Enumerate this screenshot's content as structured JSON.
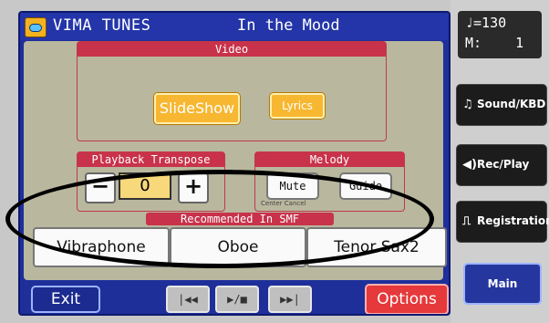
{
  "titlebar": {
    "app_name": "VIMA TUNES",
    "song_title": "In the Mood"
  },
  "video": {
    "header": "Video",
    "slideshow_label": "SlideShow",
    "lyrics_label": "Lyrics"
  },
  "transpose": {
    "header": "Playback Transpose",
    "minus_label": "−",
    "value": "0",
    "plus_label": "+"
  },
  "melody": {
    "header": "Melody",
    "mute_label": "Mute",
    "guide_label": "Guide",
    "center_cancel": "Center Cancel"
  },
  "smf": {
    "header": "Recommended In SMF",
    "items": [
      "Vibraphone",
      "Oboe",
      "Tenor Sax2"
    ]
  },
  "footer": {
    "exit_label": "Exit",
    "prev_label": "|◀◀",
    "play_stop_label": "▶/■",
    "next_label": "▶▶|",
    "options_label": "Options"
  },
  "sidebar": {
    "tempo": {
      "note_symbol": "♩",
      "tempo_text": "=130",
      "measure_label": "M:",
      "measure_value": "1"
    },
    "buttons": [
      {
        "label": "Sound/KBD",
        "icon": "music-notes-icon"
      },
      {
        "label": "Rec/Play",
        "icon": "speaker-icon"
      },
      {
        "label": "Registration",
        "icon": "book-icon"
      }
    ],
    "main_label": "Main"
  },
  "colors": {
    "screen_bg": "#1e2f9a",
    "panel_bg": "#b9b79e",
    "header_red": "#c8324a",
    "yellow_button": "#f7b731",
    "options_red": "#e5393b"
  }
}
